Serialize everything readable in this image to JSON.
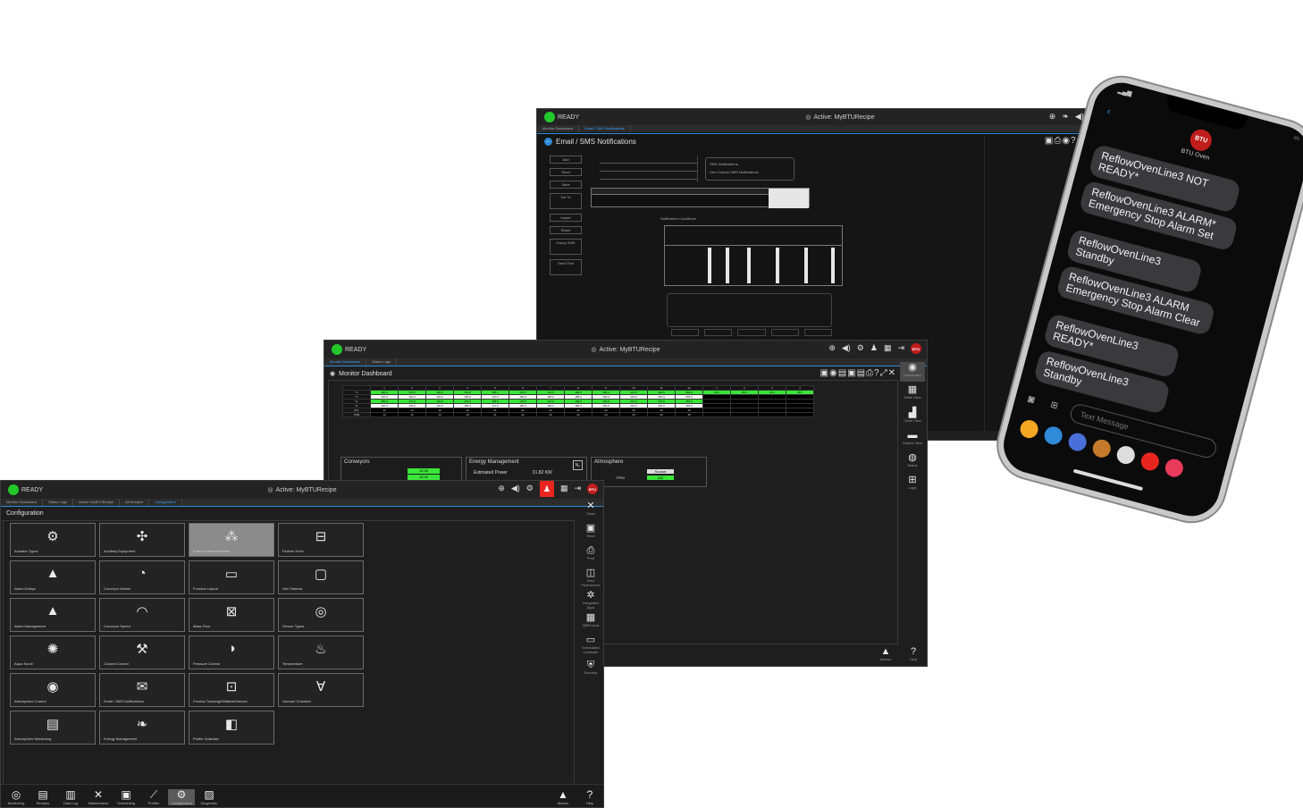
{
  "colors": {
    "ready": "#22c72a",
    "accent": "#2f8ad8",
    "alarm": "#e8261f",
    "green_cell": "#39e639",
    "btu_red": "#c01d1d"
  },
  "email_window": {
    "status": "READY",
    "active_recipe": "Active: MyBTURecipe",
    "tabs": [
      "Monitor Dashboard",
      "Email / SMS Notifications"
    ],
    "page_title": "Email / SMS Notifications",
    "left_buttons": [
      "Add",
      "Send",
      "Save",
      "Set To",
      "Import",
      "Reset",
      "Group SMS",
      "Send Test"
    ],
    "options": [
      "SMS Notifications",
      "Use Custom SMS Notifications"
    ],
    "section": "Notification Conditions"
  },
  "monitor_window": {
    "status": "READY",
    "active_recipe": "Active: MyBTURecipe",
    "tabs": [
      "Monitor Dashboard",
      "Status Logs"
    ],
    "page_title": "Monitor Dashboard",
    "zones": [
      "1",
      "2",
      "3",
      "4",
      "5",
      "6",
      "7",
      "8",
      "9",
      "10",
      "11",
      "12",
      "1",
      "2",
      "3",
      "4"
    ],
    "row_units": [
      "°C",
      "°C",
      "%",
      "%",
      "INC",
      "PPM"
    ],
    "rows": [
      [
        "180.4",
        "170.5",
        "130.2",
        "153.8",
        "165.7",
        "170.5",
        "170.5",
        "183.5",
        "190.4",
        "210.5",
        "240.5",
        "252.9",
        "26.1",
        "26.5",
        "26.1",
        "26.5"
      ],
      [
        "110.0",
        "120.0",
        "140.0",
        "155.0",
        "170.0",
        "180.0",
        "180.0",
        "185.0",
        "200.0",
        "220.0",
        "250.0",
        "255.0",
        "",
        "",
        "",
        ""
      ],
      [
        "180.9",
        "170.9",
        "130.9",
        "153.9",
        "168.9",
        "170.9",
        "170.9",
        "183.5",
        "190.9",
        "210.2",
        "247.0",
        "253.0",
        "",
        "",
        "",
        ""
      ],
      [
        "110.0",
        "120.0",
        "140.0",
        "155.0",
        "170.0",
        "180.0",
        "180.0",
        "185.0",
        "200.0",
        "220.0",
        "250.0",
        "255.0",
        "",
        "",
        "",
        ""
      ],
      [
        "14",
        "14",
        "16",
        "19",
        "21",
        "22",
        "22",
        "22",
        "24",
        "26",
        "30",
        "30",
        "",
        "",
        "",
        ""
      ],
      [
        "13",
        "15",
        "16",
        "19",
        "21",
        "22",
        "22",
        "22",
        "24",
        "26",
        "30",
        "30",
        "",
        "",
        "",
        ""
      ]
    ],
    "panels": {
      "conveyors": {
        "title": "Conveyors",
        "values": [
          "12.00",
          "12.00"
        ]
      },
      "energy": {
        "title": "Energy Management",
        "label": "Estimated Power",
        "value": "31.82 KW"
      },
      "atmosphere": {
        "title": "Atmosphere",
        "source_label": "Source",
        "unit": "PPM",
        "value": "102"
      }
    },
    "rail": [
      {
        "icon": "dashboard-icon",
        "label": "Dashboard",
        "glyph": "◉"
      },
      {
        "icon": "table-icon",
        "label": "Table View",
        "glyph": "▦"
      },
      {
        "icon": "chart-icon",
        "label": "Chart View",
        "glyph": "▟"
      },
      {
        "icon": "classic-icon",
        "label": "Classic View",
        "glyph": "▬"
      },
      {
        "icon": "status-icon",
        "label": "Status",
        "glyph": "◍"
      },
      {
        "icon": "logs-icon",
        "label": "Logs",
        "glyph": "⊞"
      }
    ],
    "alarm_label": "Alarms",
    "help_label": "Help"
  },
  "config_window": {
    "status": "READY",
    "active_recipe": "Active: MyBTURecipe",
    "tabs": [
      "Monitor Dashboard",
      "Status Logs",
      "Active: MyBTURecipe",
      "All Recipes",
      "Configuration"
    ],
    "page_title": "Configuration",
    "tiles": [
      {
        "label": "Actuator Types",
        "glyph": "⚙"
      },
      {
        "label": "Auxiliary Equipment",
        "glyph": "✣"
      },
      {
        "label": "External Alarms/Events",
        "glyph": "⁂"
      },
      {
        "label": "Flusher Drive",
        "glyph": "⊟"
      },
      {
        "label": "Alarm Delays",
        "glyph": "▲"
      },
      {
        "label": "Conveyor Motion",
        "glyph": "◔"
      },
      {
        "label": "Furnace Layout",
        "glyph": "▭"
      },
      {
        "label": "Hot Flatness",
        "glyph": "▢"
      },
      {
        "label": "Alarm Management",
        "glyph": "▲"
      },
      {
        "label": "Conveyor Speed",
        "glyph": "◠"
      },
      {
        "label": "Mass Flow",
        "glyph": "⊠"
      },
      {
        "label": "Sensor Types",
        "glyph": "◎"
      },
      {
        "label": "Aqua Scrub",
        "glyph": "✺"
      },
      {
        "label": "Custom Control",
        "glyph": "⚒"
      },
      {
        "label": "Pressure Control",
        "glyph": "◑"
      },
      {
        "label": "Temperature",
        "glyph": "♨"
      },
      {
        "label": "Atmosphere Control",
        "glyph": "◉"
      },
      {
        "label": "Email / SMS Notifications",
        "glyph": "✉"
      },
      {
        "label": "Product Tracking/Shiftable/Heroes",
        "glyph": "⊡"
      },
      {
        "label": "Vacuum Chamber",
        "glyph": "∀"
      },
      {
        "label": "Atmosphere Monitoring",
        "glyph": "▤"
      },
      {
        "label": "Energy Management",
        "glyph": "❧"
      },
      {
        "label": "Profile Guardian",
        "glyph": "◧"
      }
    ],
    "rail": [
      {
        "label": "Close",
        "glyph": "✕"
      },
      {
        "label": "Save",
        "glyph": "▣"
      },
      {
        "label": "Print",
        "glyph": "⎙"
      },
      {
        "label": "View Preferences",
        "glyph": "◫"
      },
      {
        "label": "Integrated Apps",
        "glyph": "✲"
      },
      {
        "label": "QRB Hook",
        "glyph": "▦"
      },
      {
        "label": "Embedded Controller",
        "glyph": "▭"
      },
      {
        "label": "Security",
        "glyph": "⛨"
      }
    ],
    "nav": [
      {
        "label": "Monitoring",
        "glyph": "◎"
      },
      {
        "label": "Recipes",
        "glyph": "▤"
      },
      {
        "label": "Data Log",
        "glyph": "▥"
      },
      {
        "label": "Maintenance",
        "glyph": "✕"
      },
      {
        "label": "Scheduling",
        "glyph": "▣"
      },
      {
        "label": "Profiler",
        "glyph": "⟋"
      },
      {
        "label": "Configuration",
        "glyph": "⚙"
      },
      {
        "label": "Diagnostic",
        "glyph": "▨"
      }
    ],
    "alarm_label": "Alarms",
    "help_label": "Help"
  },
  "phone": {
    "contact": "BTU Oven",
    "avatar_text": "BTU",
    "messages": [
      "ReflowOvenLine3 NOT READY*",
      "ReflowOvenLine3 ALARM* Emergency Stop Alarm Set",
      "ReflowOvenLine3 Standby",
      "ReflowOvenLine3 ALARM Emergency Stop Alarm Clear",
      "ReflowOvenLine3 READY*",
      "ReflowOvenLine3 Standby"
    ],
    "input_placeholder": "Text Message"
  }
}
